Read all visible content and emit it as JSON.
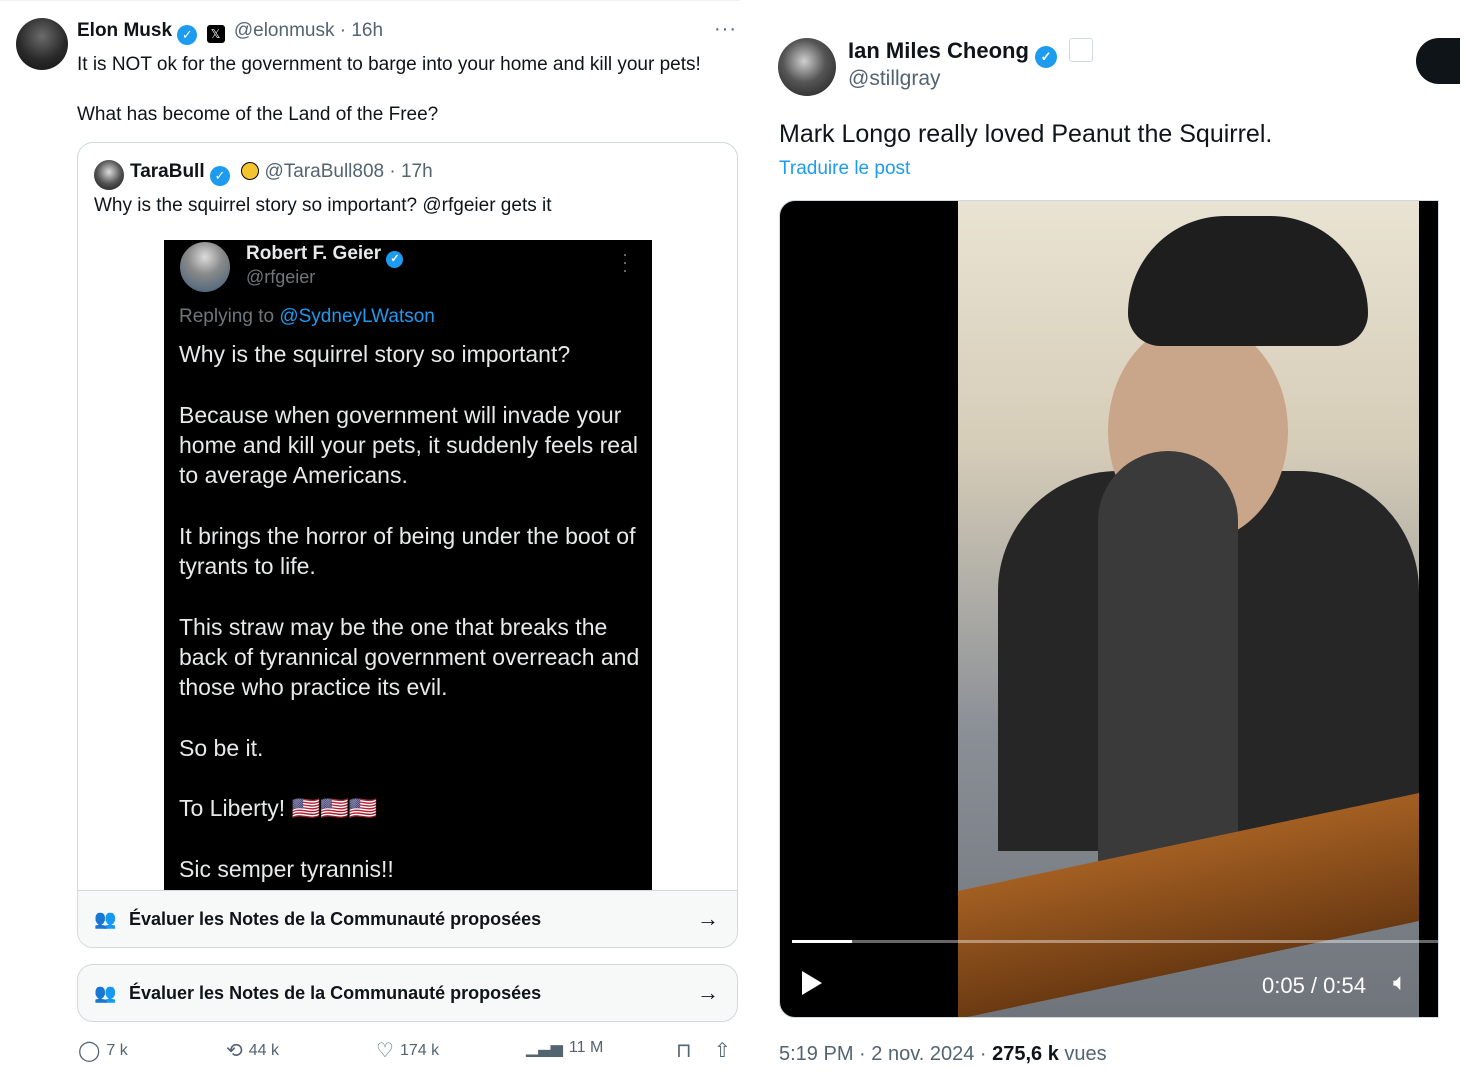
{
  "musk_tweet": {
    "name": "Elon Musk",
    "x_badge": "𝕏",
    "handle": "@elonmusk",
    "time": "16h",
    "more": "···",
    "text": "It is NOT ok for the government to barge into your home and kill your pets!\n\nWhat has become of the Land of the Free?"
  },
  "quote": {
    "name": "TaraBull",
    "handle": "@TaraBull808",
    "time": "17h",
    "text": "Why is the squirrel story so important? @rfgeier gets it"
  },
  "embedded_screenshot": {
    "name": "Robert F. Geier",
    "handle": "@rfgeier",
    "replying_prefix": "Replying to ",
    "replying_handle": "@SydneyLWatson",
    "body": "Why is the squirrel story so important?\n\nBecause when government will invade your home and kill your pets, it suddenly feels real to average Americans.\n\nIt brings the horror of being under the boot of tyrants to life.\n\nThis straw may be the one that breaks the back of tyrannical government overreach and those who practice its evil.\n\nSo be it.\n\nTo Liberty! 🇺🇸🇺🇸🇺🇸\n\nSic semper tyrannis!!"
  },
  "community_notes": {
    "label": "Évaluer les Notes de la Communauté proposées",
    "icon": "people-icon",
    "arrow": "→"
  },
  "actions": {
    "replies": "7 k",
    "reposts": "44 k",
    "likes": "174 k",
    "views": "11 M"
  },
  "cheong_tweet": {
    "name": "Ian Miles Cheong",
    "handle": "@stillgray",
    "text": "Mark Longo really loved Peanut the Squirrel.",
    "translate": "Traduire le post",
    "video_time": "0:05 / 0:54",
    "video_progress": 0.093,
    "meta_time": "5:19 PM",
    "meta_sep": " · ",
    "meta_date": "2 nov. 2024",
    "meta_views": "275,6 k",
    "meta_views_label": " vues"
  },
  "colors": {
    "accent": "#1d9bf0",
    "text": "#0f1419",
    "muted": "#536471"
  }
}
